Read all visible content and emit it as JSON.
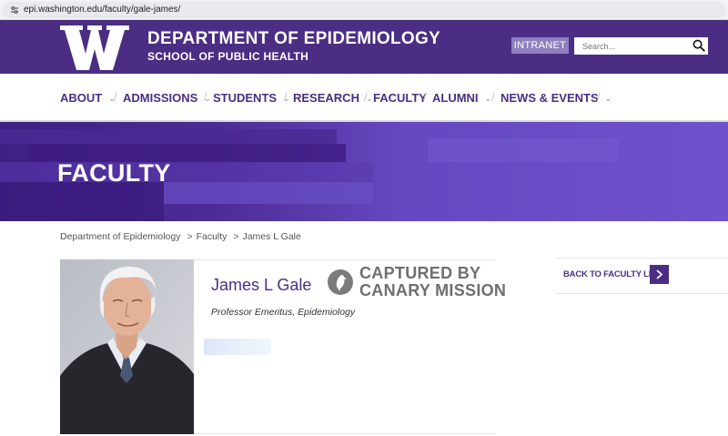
{
  "browser": {
    "url": "epi.washington.edu/faculty/gale-james/"
  },
  "header": {
    "logo_icon": "uw-w-logo",
    "department": "DEPARTMENT OF EPIDEMIOLOGY",
    "school": "SCHOOL OF PUBLIC HEALTH",
    "intranet_label": "INTRANET",
    "search_placeholder": "Search...",
    "search_icon": "search-icon"
  },
  "nav": {
    "items": [
      {
        "label": "ABOUT",
        "has_dropdown": true
      },
      {
        "label": "ADMISSIONS",
        "has_dropdown": true
      },
      {
        "label": "STUDENTS",
        "has_dropdown": true
      },
      {
        "label": "RESEARCH",
        "has_dropdown": true
      },
      {
        "label": "FACULTY",
        "has_dropdown": false
      },
      {
        "label": "ALUMNI",
        "has_dropdown": true
      },
      {
        "label": "NEWS & EVENTS",
        "has_dropdown": true
      }
    ]
  },
  "banner": {
    "title": "FACULTY"
  },
  "breadcrumb": {
    "items": [
      "Department of Epidemiology",
      "Faculty",
      "James L Gale"
    ],
    "separator": ">"
  },
  "profile": {
    "name": "James L Gale",
    "title": "Professor Emeritus, Epidemiology",
    "stamp_line1": "CAPTURED BY",
    "stamp_line2": "CANARY MISSION"
  },
  "sidebar": {
    "back_label": "BACK TO FACULTY LIST",
    "back_icon": "chevron-right-icon"
  },
  "colors": {
    "uw_purple": "#4b2e83",
    "banner_purple": "#6b4bc4",
    "intranet": "#8f7fbf",
    "stamp_gray": "#6f6f6f"
  }
}
